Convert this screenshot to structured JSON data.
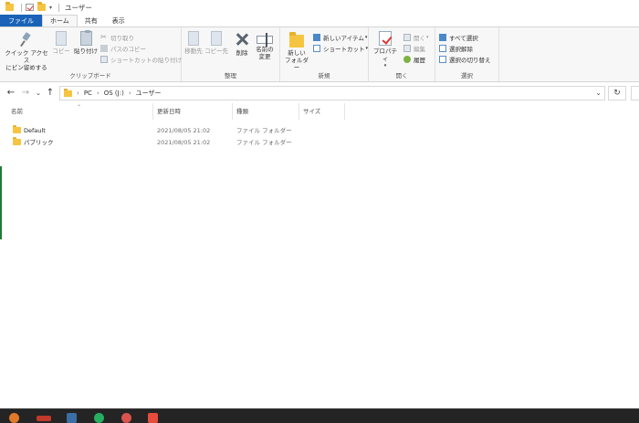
{
  "window": {
    "title": "ユーザー"
  },
  "tabs": [
    {
      "label": "ファイル"
    },
    {
      "label": "ホーム"
    },
    {
      "label": "共有"
    },
    {
      "label": "表示"
    }
  ],
  "ribbon": {
    "clipboard": {
      "pin_label_1": "クイック アクセス",
      "pin_label_2": "にピン留めする",
      "copy": "コピー",
      "paste": "貼り付け",
      "cut": "切り取り",
      "copy_path": "パスのコピー",
      "paste_shortcut": "ショートカットの貼り付け",
      "group": "クリップボード"
    },
    "organize": {
      "move_to": "移動先",
      "copy_to": "コピー先",
      "delete": "削除",
      "rename_1": "名前の",
      "rename_2": "変更",
      "group": "整理"
    },
    "new": {
      "new_folder_1": "新しい",
      "new_folder_2": "フォルダー",
      "new_item": "新しいアイテム",
      "shortcut": "ショートカット",
      "group": "新規"
    },
    "open": {
      "properties": "プロパティ",
      "open": "開く",
      "edit": "編集",
      "history": "履歴",
      "group": "開く"
    },
    "select": {
      "select_all": "すべて選択",
      "select_none": "選択解除",
      "invert": "選択の切り替え",
      "group": "選択"
    }
  },
  "address": {
    "crumbs": [
      "PC",
      "OS (J:)",
      "ユーザー"
    ]
  },
  "columns": {
    "name": "名前",
    "date": "更新日時",
    "type": "種類",
    "size": "サイズ"
  },
  "files": [
    {
      "name": "Default",
      "date": "2021/08/05 21:02",
      "type": "ファイル フォルダー",
      "size": ""
    },
    {
      "name": "パブリック",
      "date": "2021/08/05 21:02",
      "type": "ファイル フォルダー",
      "size": ""
    }
  ],
  "colors": {
    "file_tab": "#1a63b8",
    "folder": "#f5c542",
    "taskbar": "#242424"
  }
}
